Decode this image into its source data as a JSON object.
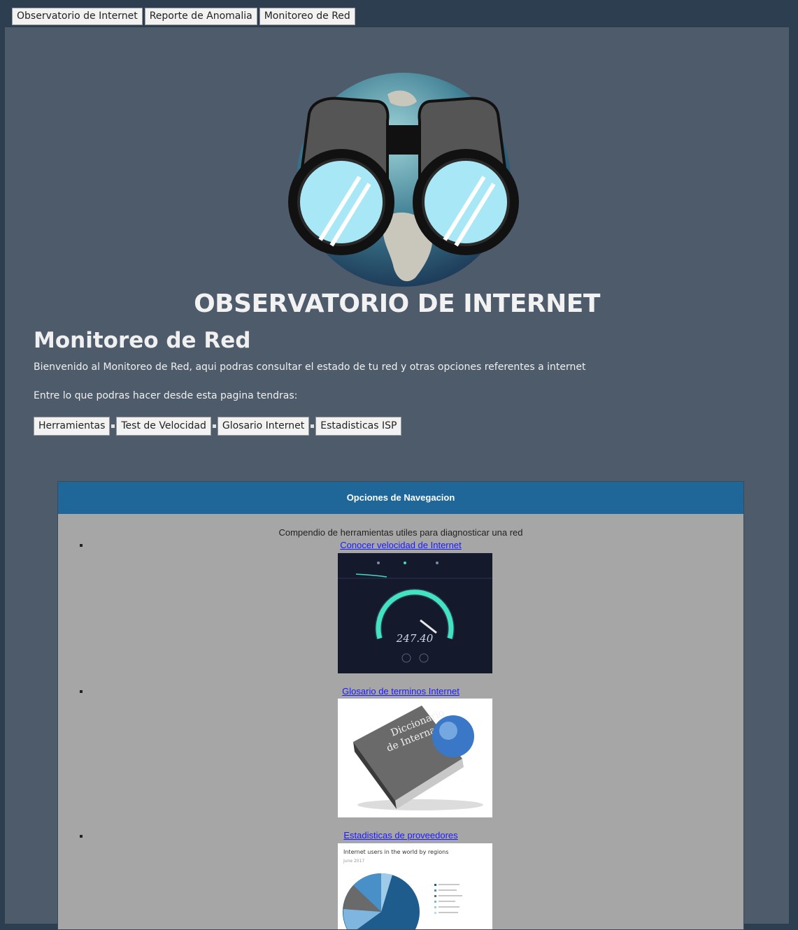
{
  "topnav": {
    "items": [
      {
        "label": "Observatorio de Internet"
      },
      {
        "label": "Reporte de Anomalia"
      },
      {
        "label": "Monitoreo de Red"
      }
    ]
  },
  "header": {
    "site_title": "OBSERVATORIO DE INTERNET",
    "logo_icon": "binoculars-globe-logo"
  },
  "page": {
    "title": "Monitoreo de Red",
    "intro": "Bienvenido al Monitoreo de Red, aqui podras consultar el estado de tu red y otras opciones referentes a internet",
    "lead": "Entre lo que podras hacer desde esta pagina tendras:"
  },
  "subnav": {
    "items": [
      {
        "label": "Herramientas"
      },
      {
        "label": "Test de Velocidad"
      },
      {
        "label": "Glosario Internet"
      },
      {
        "label": "Estadisticas ISP"
      }
    ]
  },
  "panel": {
    "header": "Opciones de Navegacion",
    "intro": "Compendio de herramientas utiles para diagnosticar una red",
    "items": [
      {
        "link": "Conocer velocidad de Internet",
        "image": "speedtest-gauge-image",
        "speed_value": "247.40"
      },
      {
        "link": "Glosario de terminos Internet",
        "image": "dictionary-book-image",
        "book_title": "Diccionario de Internautas"
      },
      {
        "link": "Estadisticas de proveedores",
        "image": "pie-chart-image",
        "chart_title": "Internet users in the world by regions",
        "chart_subtitle": "June 2017"
      }
    ]
  },
  "colors": {
    "page_bg": "#2c3e50",
    "content_bg": "#4d5b6b",
    "panel_header": "#1f6699",
    "panel_body": "#a6a6a6",
    "link": "#1a1aff"
  }
}
